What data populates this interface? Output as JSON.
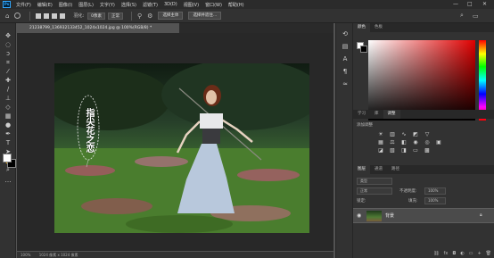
{
  "app": {
    "logo": "Ps"
  },
  "menubar": {
    "items": [
      "文件(F)",
      "编辑(E)",
      "图像(I)",
      "图层(L)",
      "文字(Y)",
      "选择(S)",
      "滤镜(T)",
      "3D(D)",
      "视图(V)",
      "窗口(W)",
      "帮助(H)"
    ],
    "window_controls": [
      "—",
      "□",
      "✕"
    ]
  },
  "options": {
    "feather_label": "羽化:",
    "feather_value": "0像素",
    "style_value": "正常",
    "select_subject_label": "选择主体",
    "refine_label": "选择并遮住..."
  },
  "document": {
    "tab_title": "21238799_136932133452_1024x1024.jpg @ 100%(RGB/8) *",
    "image_text": "指尖花之恋",
    "zoom": "100%",
    "dimensions": "1024 像素 x 1024 像素"
  },
  "panels": {
    "color_tabs": [
      "颜色",
      "色板"
    ],
    "learn_tabs": [
      "学习",
      "库",
      "调整"
    ],
    "add_adjustment": "添加调整",
    "layer_tabs": [
      "图层",
      "通道",
      "路径"
    ],
    "kind_placeholder": "类型",
    "blend_mode": "正常",
    "opacity_label": "不透明度:",
    "opacity_value": "100%",
    "lock_label": "锁定:",
    "fill_label": "填充:",
    "fill_value": "100%",
    "layer_name": "背景"
  },
  "colors": {
    "accent": "#31a8ff",
    "background": "#535353",
    "foreground_swatch": "#ffffff",
    "background_swatch": "#000000"
  }
}
